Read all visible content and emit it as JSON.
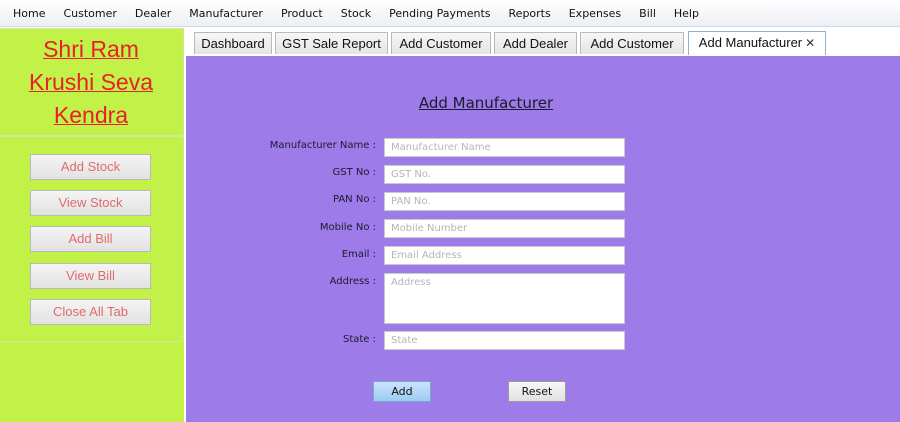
{
  "menu": [
    "Home",
    "Customer",
    "Dealer",
    "Manufacturer",
    "Product",
    "Stock",
    "Pending Payments",
    "Reports",
    "Expenses",
    "Bill",
    "Help"
  ],
  "brand": {
    "line1": "Shri Ram ",
    "line2": "Krushi Seva ",
    "line3": "Kendra"
  },
  "sidebar": {
    "buttons": [
      "Add Stock",
      "View Stock",
      "Add Bill",
      "View Bill",
      "Close All Tab"
    ]
  },
  "tabs": [
    "Dashboard",
    "GST Sale Report",
    "Add Customer",
    "Add Dealer",
    "Add Customer",
    "Add Manufacturer"
  ],
  "active_tab_close": "✕",
  "form": {
    "title": "Add Manufacturer",
    "fields": [
      {
        "label": "Manufacturer Name :",
        "placeholder": "Manufacturer Name"
      },
      {
        "label": "GST No :",
        "placeholder": "GST No."
      },
      {
        "label": "PAN No :",
        "placeholder": "PAN No."
      },
      {
        "label": "Mobile No :",
        "placeholder": "Mobile Number"
      },
      {
        "label": "Email :",
        "placeholder": "Email Address"
      },
      {
        "label": "Address :",
        "placeholder": "Address"
      },
      {
        "label": "State :",
        "placeholder": "State"
      }
    ],
    "add_label": "Add",
    "reset_label": "Reset"
  },
  "colors": {
    "sidebar_bg": "#c2f147",
    "brand_text": "#e8202a",
    "panel_bg": "#9d7be8",
    "side_button_text": "#e06b6b"
  }
}
